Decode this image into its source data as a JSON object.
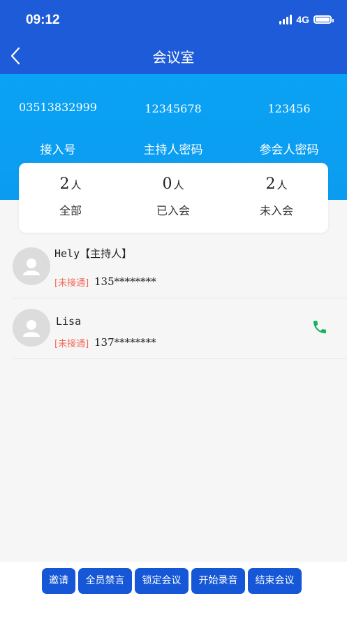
{
  "status": {
    "time": "09:12",
    "network": "4G"
  },
  "nav": {
    "title": "会议室"
  },
  "info": [
    {
      "value": "03513832999",
      "label": "接入号"
    },
    {
      "value": "12345678",
      "label": "主持人密码"
    },
    {
      "value": "123456",
      "label": "参会人密码"
    }
  ],
  "stats": [
    {
      "count": "2",
      "unit": "人",
      "label": "全部"
    },
    {
      "count": "0",
      "unit": "人",
      "label": "已入会"
    },
    {
      "count": "2",
      "unit": "人",
      "label": "未入会"
    }
  ],
  "members": [
    {
      "name": "Hely【主持人】",
      "status": "[未接通]",
      "phone": "135********"
    },
    {
      "name": "Lisa",
      "status": "[未接通]",
      "phone": "137********"
    }
  ],
  "actions": {
    "invite": "邀请",
    "mute_all": "全员禁言",
    "lock": "锁定会议",
    "record": "开始录音",
    "end": "结束会议"
  },
  "colors": {
    "header": "#1e5bd8",
    "info_band": "#0aa2f4",
    "button": "#1557d6",
    "status_text": "#f26b5b",
    "call_icon": "#16b45a"
  }
}
